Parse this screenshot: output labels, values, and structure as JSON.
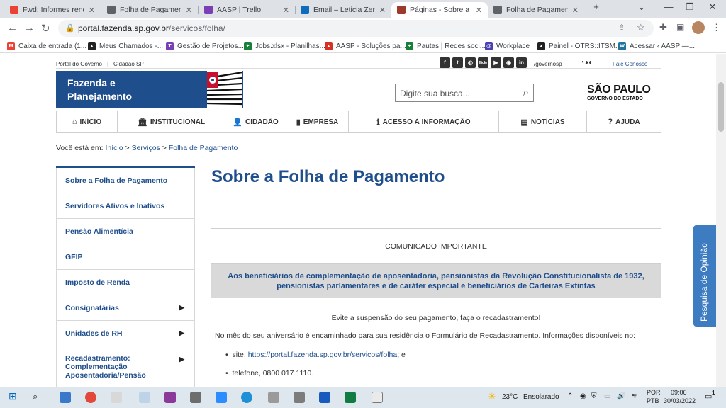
{
  "browser": {
    "tabs": [
      {
        "label": "Fwd: Informes rendim",
        "icon": "gmail-icon",
        "color": "#ea4335",
        "active": false
      },
      {
        "label": "Folha de Pagamento -",
        "icon": "globe-icon",
        "color": "#5f6368",
        "active": false
      },
      {
        "label": "AASP | Trello",
        "icon": "trello-icon",
        "color": "#7b3fb5",
        "active": false
      },
      {
        "label": "Email – Leticia Zerbat",
        "icon": "outlook-icon",
        "color": "#0f6cbd",
        "active": false
      },
      {
        "label": "Páginas - Sobre a Foll",
        "icon": "sp-seal-icon",
        "color": "#9c3b2b",
        "active": true
      },
      {
        "label": "Folha de Pagamento -",
        "icon": "globe-icon",
        "color": "#5f6368",
        "active": false
      }
    ],
    "new_tab": "+",
    "url_host": "portal.fazenda.sp.gov.br",
    "url_path": "/servicos/folha/",
    "bookmarks": [
      {
        "label": "Caixa de entrada (1...",
        "color": "#ea4335",
        "glyph": "M"
      },
      {
        "label": "Meus Chamados -...",
        "color": "#222",
        "glyph": "▲"
      },
      {
        "label": "Gestão de Projetos...",
        "color": "#7b3fb5",
        "glyph": "T"
      },
      {
        "label": "Jobs.xlsx - Planilhas...",
        "color": "#188038",
        "glyph": "+"
      },
      {
        "label": "AASP - Soluções pa...",
        "color": "#d93025",
        "glyph": "▲"
      },
      {
        "label": "Pautas | Redes soci...",
        "color": "#188038",
        "glyph": "+"
      },
      {
        "label": "Workplace",
        "color": "#4b3fb5",
        "glyph": "@"
      },
      {
        "label": "Painel - OTRS::ITSM...",
        "color": "#222",
        "glyph": "▲"
      },
      {
        "label": "Acessar ‹ AASP —...",
        "color": "#21759b",
        "glyph": "W"
      }
    ]
  },
  "site": {
    "top_links": [
      "Portal do Governo",
      "Cidadão SP"
    ],
    "social": [
      "f",
      "t",
      "◎",
      "flickr",
      "▶",
      "◉",
      "in"
    ],
    "social_handle": "/governosp",
    "contact": "Fale Conosco",
    "banner_line1": "Fazenda e",
    "banner_line2": "Planejamento",
    "search_placeholder": "Digite sua busca...",
    "logo_main": "SÃO PAULO",
    "logo_sub": "GOVERNO DO ESTADO",
    "nav": [
      {
        "label": "INÍCIO",
        "glyph": "⌂"
      },
      {
        "label": "INSTITUCIONAL",
        "glyph": "🏛"
      },
      {
        "label": "CIDADÃO",
        "glyph": "👤"
      },
      {
        "label": "EMPRESA",
        "glyph": "▮"
      },
      {
        "label": "ACESSO À INFORMAÇÃO",
        "glyph": "ℹ"
      },
      {
        "label": "NOTÍCIAS",
        "glyph": "▤"
      },
      {
        "label": "AJUDA",
        "glyph": "?"
      }
    ],
    "breadcrumb_prefix": "Você está em:",
    "breadcrumb": [
      "Início",
      "Serviços",
      "Folha de Pagamento"
    ],
    "side_menu": [
      {
        "label": "Sobre a Folha de Pagamento",
        "arrow": false
      },
      {
        "label": "Servidores Ativos e Inativos",
        "arrow": false
      },
      {
        "label": "Pensão Alimentícia",
        "arrow": false
      },
      {
        "label": "GFIP",
        "arrow": false
      },
      {
        "label": "Imposto de Renda",
        "arrow": false
      },
      {
        "label": "Consignatárias",
        "arrow": true
      },
      {
        "label": "Unidades de RH",
        "arrow": true
      },
      {
        "label": "Recadastramento: Complementação Aposentadoria/Pensão",
        "arrow": true
      }
    ],
    "page_title": "Sobre a Folha de Pagamento",
    "notice": {
      "heading": "COMUNICADO IMPORTANTE",
      "band": "Aos  beneficiários de complementação de aposentadoria, pensionistas da Revolução Constitucionalista de 1932, pensionistas parlamentares e de caráter especial e beneficiários de Carteiras Extintas",
      "p1": "Evite a suspensão do seu pagamento, faça o recadastramento!",
      "p2": "No mês do seu aniversário é encaminhado para sua residência o Formulário de Recadastramento. Informações disponíveis no:",
      "item1_prefix": "site, ",
      "item1_link": "https://portal.fazenda.sp.gov.br/servicos/folha",
      "item1_suffix": "; e",
      "item2": "telefone, 0800 017 1110."
    },
    "feedback_tab": "Pesquisa de Opinião"
  },
  "taskbar": {
    "weather_temp": "23°C",
    "weather_text": "Ensolarado",
    "lang1": "POR",
    "lang2": "PTB",
    "time": "09:06",
    "date": "30/03/2022",
    "notifications": "1"
  }
}
